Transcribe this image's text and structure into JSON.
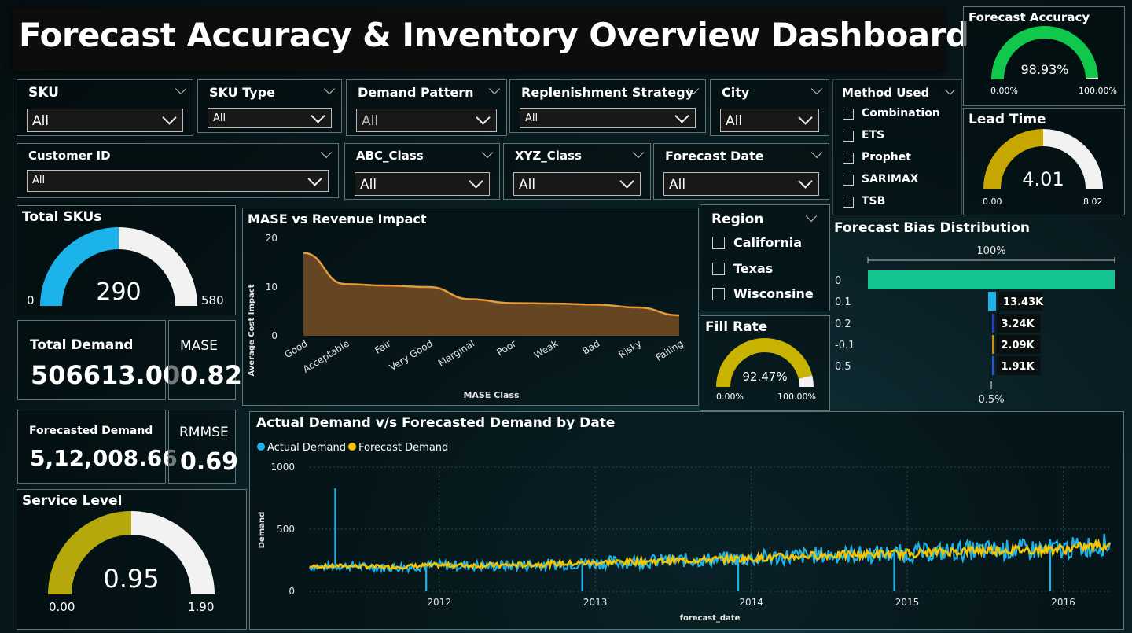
{
  "title": "Forecast Accuracy & Inventory Overview Dashboard",
  "colors": {
    "accent_blue": "#1bb3ea",
    "gauge_green": "#10c84c",
    "gauge_gold": "#c8a800",
    "gauge_olive": "#b5a80c",
    "bias_teal": "#13c490",
    "area_fill": "#6b4824",
    "area_line": "#e59a3c",
    "actual": "#1bb3ea",
    "forecast": "#f5c400"
  },
  "slicers": {
    "sku": {
      "label": "SKU",
      "value": "All"
    },
    "sku_type": {
      "label": "SKU Type",
      "value": "All"
    },
    "demand_pattern": {
      "label": "Demand Pattern",
      "value": "All"
    },
    "replenishment": {
      "label": "Replenishment Strategy",
      "value": "All"
    },
    "city": {
      "label": "City",
      "value": "All"
    },
    "customer_id": {
      "label": "Customer ID",
      "value": "All"
    },
    "abc_class": {
      "label": "ABC_Class",
      "value": "All"
    },
    "xyz_class": {
      "label": "XYZ_Class",
      "value": "All"
    },
    "forecast_date": {
      "label": "Forecast Date",
      "value": "All"
    }
  },
  "method_used": {
    "label": "Method Used",
    "options": [
      "Combination",
      "ETS",
      "Prophet",
      "SARIMAX",
      "TSB"
    ]
  },
  "region": {
    "label": "Region",
    "options": [
      "California",
      "Texas",
      "Wisconsine"
    ]
  },
  "forecast_accuracy": {
    "title": "Forecast Accuracy",
    "value": "98.93%",
    "min": "0.00%",
    "max": "100.00%",
    "fraction": 0.9893
  },
  "lead_time": {
    "title": "Lead Time",
    "value": "4.01",
    "min": "0.00",
    "max": "8.02",
    "fraction": 0.5
  },
  "total_skus": {
    "title": "Total SKUs",
    "value": "290",
    "min": "0",
    "max": "580",
    "fraction": 0.5
  },
  "total_demand": {
    "label": "Total Demand",
    "value": "506613.00"
  },
  "mase": {
    "label": "MASE",
    "value": "0.82"
  },
  "forecasted_demand": {
    "label": "Forecasted Demand",
    "value": "5,12,008.66"
  },
  "rmmse": {
    "label": "RMMSE",
    "value": "0.69"
  },
  "service_level": {
    "title": "Service Level",
    "value": "0.95",
    "min": "0.00",
    "max": "1.90",
    "fraction": 0.5
  },
  "fill_rate": {
    "title": "Fill Rate",
    "value": "92.47%",
    "min": "0.00%",
    "max": "100.00%",
    "fraction": 0.9247
  },
  "chart_data": [
    {
      "type": "area",
      "title": "MASE vs Revenue Impact",
      "xlabel": "MASE Class",
      "ylabel": "Average Cost Impact",
      "categories": [
        "Good",
        "Acceptable",
        "Fair",
        "Very Good",
        "Marginal",
        "Poor",
        "Weak",
        "Bad",
        "Risky",
        "Failing"
      ],
      "values": [
        17,
        10.6,
        10.3,
        10,
        7.5,
        6.7,
        6.6,
        6.4,
        5.8,
        4.2
      ],
      "ylim": [
        0,
        20
      ],
      "yticks": [
        0,
        10,
        20
      ]
    },
    {
      "type": "bar",
      "title": "Forecast Bias Distribution",
      "orientation": "horizontal",
      "categories": [
        "0",
        "0.1",
        "0.2",
        "-0.1",
        "0.5"
      ],
      "values": [
        100,
        13430,
        3240,
        2090,
        1910
      ],
      "labels": [
        "100%",
        "13.43K",
        "3.24K",
        "2.09K",
        "1.91K"
      ],
      "top_label": "100%",
      "bottom_label": "0.5%",
      "colors": [
        "#13c490",
        "#1bb3ea",
        "#2a3cbe",
        "#c89018",
        "#2a58c8"
      ]
    },
    {
      "type": "line",
      "title": "Actual Demand v/s Forecasted Demand by Date",
      "xlabel": "forecast_date",
      "ylabel": "Demand",
      "ylim": [
        0,
        1000
      ],
      "yticks": [
        0,
        500,
        1000
      ],
      "xticks": [
        "2012",
        "2013",
        "2014",
        "2015",
        "2016"
      ],
      "series": [
        {
          "name": "Actual Demand",
          "x": [
            "2011-03",
            "2011-06",
            "2011-09",
            "2012-01",
            "2012-06",
            "2013-01",
            "2013-06",
            "2014-01",
            "2014-06",
            "2015-01",
            "2015-06",
            "2016-01",
            "2016-04"
          ],
          "values": [
            195,
            205,
            190,
            210,
            205,
            230,
            245,
            265,
            290,
            305,
            330,
            340,
            375
          ]
        },
        {
          "name": "Forecast Demand",
          "x": [
            "2011-03",
            "2011-06",
            "2011-09",
            "2012-01",
            "2012-06",
            "2013-01",
            "2013-06",
            "2014-01",
            "2014-06",
            "2015-01",
            "2015-06",
            "2016-01",
            "2016-04"
          ],
          "values": [
            200,
            205,
            195,
            210,
            210,
            230,
            245,
            265,
            290,
            305,
            330,
            340,
            370
          ]
        }
      ],
      "spikes": [
        {
          "x": "2011-05",
          "value": 830
        },
        {
          "x": "2011-12",
          "value": 0
        },
        {
          "x": "2012-12",
          "value": 0
        },
        {
          "x": "2013-12",
          "value": 0
        },
        {
          "x": "2014-12",
          "value": 0
        },
        {
          "x": "2015-12",
          "value": 0
        }
      ]
    }
  ]
}
